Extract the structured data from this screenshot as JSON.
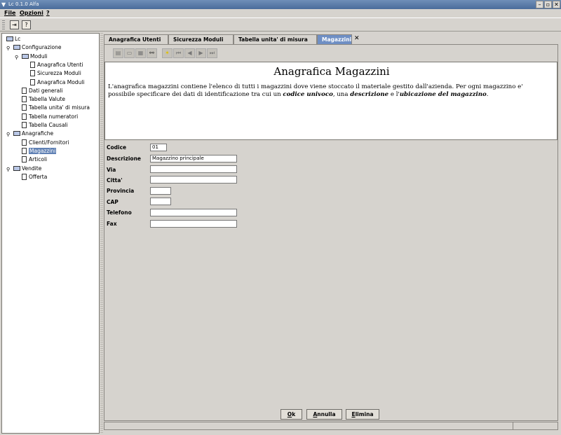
{
  "window": {
    "title": "Lc 0.1.0 Alfa"
  },
  "menu": [
    {
      "label": "File",
      "mnemonic": "F"
    },
    {
      "label": "Opzioni",
      "mnemonic": "O"
    },
    {
      "label": "?",
      "mnemonic": "?"
    }
  ],
  "toolbar": {
    "exit_icon": "exit-icon",
    "help_glyph": "?"
  },
  "tree": [
    {
      "label": "Lc",
      "level": 0,
      "type": "folder",
      "expander": ""
    },
    {
      "label": "Configurazione",
      "level": 1,
      "type": "folder",
      "expander": "⚲"
    },
    {
      "label": "Moduli",
      "level": 2,
      "type": "folder",
      "expander": "⚲"
    },
    {
      "label": "Anagrafica Utenti",
      "level": 3,
      "type": "doc"
    },
    {
      "label": "Sicurezza Moduli",
      "level": 3,
      "type": "doc"
    },
    {
      "label": "Anagrafica Moduli",
      "level": 3,
      "type": "doc"
    },
    {
      "label": "Dati generali",
      "level": 2,
      "type": "doc"
    },
    {
      "label": "Tabella Valute",
      "level": 2,
      "type": "doc"
    },
    {
      "label": "Tabella unita' di misura",
      "level": 2,
      "type": "doc"
    },
    {
      "label": "Tabella numeratori",
      "level": 2,
      "type": "doc"
    },
    {
      "label": "Tabella Causali",
      "level": 2,
      "type": "doc"
    },
    {
      "label": "Anagrafiche",
      "level": 1,
      "type": "folder",
      "expander": "⚲"
    },
    {
      "label": "Clienti/Fornitori",
      "level": 2,
      "type": "doc"
    },
    {
      "label": "Magazzini",
      "level": 2,
      "type": "doc",
      "selected": true
    },
    {
      "label": "Articoli",
      "level": 2,
      "type": "doc"
    },
    {
      "label": "Vendite",
      "level": 1,
      "type": "folder",
      "expander": "⚲"
    },
    {
      "label": "Offerta",
      "level": 2,
      "type": "doc"
    }
  ],
  "tabs": [
    {
      "label": "Anagrafica Utenti",
      "active": false
    },
    {
      "label": "Sicurezza Moduli",
      "active": false
    },
    {
      "label": "Tabella unita' di misura",
      "active": false
    },
    {
      "label": "Magazzini",
      "active": true
    }
  ],
  "tab_close": "✕",
  "actions": [
    "new-icon",
    "print-icon",
    "print-preview-icon",
    "find-icon",
    "star-icon",
    "first-icon",
    "previous-icon",
    "next-icon",
    "last-icon"
  ],
  "description": {
    "title": "Anagrafica Magazzini",
    "text_before": "L'anagrafica magazzini contiene l'elenco di tutti i magazzini dove viene stoccato il materiale gestito dall'azienda. Per ogni magazzino e' possibile specificare dei dati di identificazione tra cui un ",
    "bold1": "codice univoco",
    "mid1": ", una ",
    "bold2": "descrizione",
    "mid2": " e l'",
    "bold3": "ubicazione del magazzino",
    "text_after": "."
  },
  "form": {
    "codice": {
      "label": "Codice",
      "value": "01"
    },
    "descrizione": {
      "label": "Descrizione",
      "value": "Magazzino principale"
    },
    "via": {
      "label": "Via",
      "value": ""
    },
    "citta": {
      "label": "Citta'",
      "value": ""
    },
    "provincia": {
      "label": "Provincia",
      "value": ""
    },
    "cap": {
      "label": "CAP",
      "value": ""
    },
    "telefono": {
      "label": "Telefono",
      "value": ""
    },
    "fax": {
      "label": "Fax",
      "value": ""
    }
  },
  "buttons": {
    "ok": {
      "mnemonic": "O",
      "rest": "k"
    },
    "annulla": {
      "mnemonic": "A",
      "rest": "nnulla"
    },
    "elimina": {
      "mnemonic": "E",
      "rest": "limina"
    }
  }
}
